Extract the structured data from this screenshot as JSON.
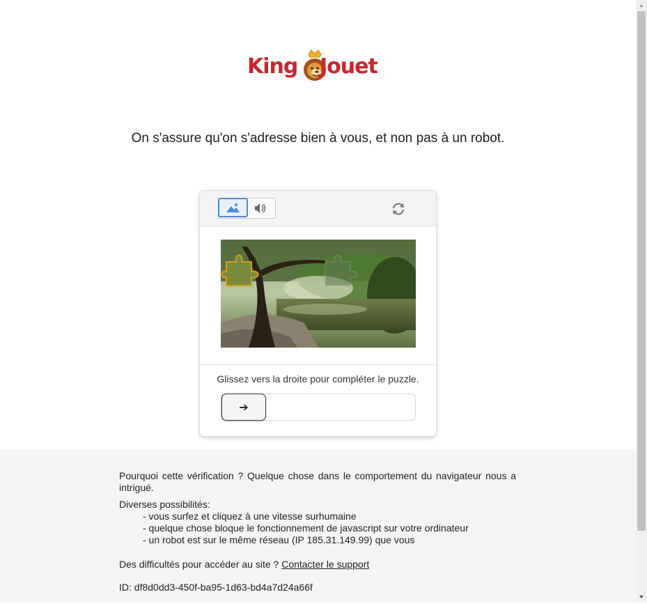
{
  "brand": {
    "name_part1": "King",
    "name_part2": "Jouet",
    "color": "#c9262d"
  },
  "headline": "On s'assure qu'on s'adresse bien à vous, et non pas à un robot.",
  "captcha": {
    "mode_image_icon": "image-icon",
    "mode_audio_icon": "speaker-icon",
    "refresh_icon": "refresh-icon",
    "instruction": "Glissez vers la droite pour compléter le puzzle.",
    "slider_handle_icon": "arrow-right-icon",
    "slider_handle_glyph": "➔",
    "slider_progress": 0
  },
  "footer": {
    "why_text": "Pourquoi cette vérification ? Quelque chose dans le comportement du navigateur nous a intrigué.",
    "possibilities_title": "Diverses possibilités:",
    "possibilities": [
      "- vous surfez et cliquez à une vitesse surhumaine",
      "- quelque chose bloque le fonctionnement de javascript sur votre ordinateur",
      "- un robot est sur le même réseau (IP 185.31.149.99) que vous"
    ],
    "support_prefix": "Des difficultés pour accéder au site ?",
    "support_link": "Contacter le support",
    "id_line": "ID: df8d0dd3-450f-ba95-1d63-bd4a7d24a66f"
  },
  "colors": {
    "accent_blue": "#4a8bd6",
    "footer_bg": "#f4f4f4"
  }
}
